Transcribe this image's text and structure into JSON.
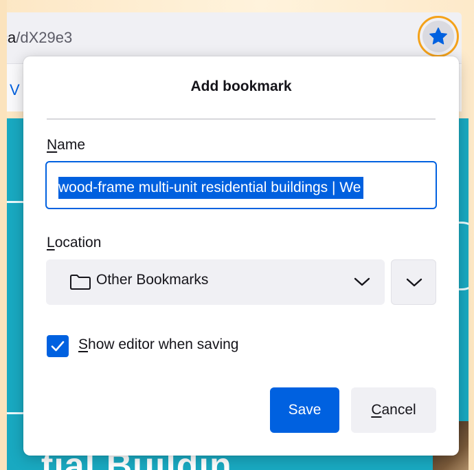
{
  "browser": {
    "url_prefix": "ca",
    "url_rest": "/dX29e3",
    "tab_letter": "V",
    "page_heading": "tial Buildin"
  },
  "panel": {
    "title": "Add bookmark",
    "name_label_accesskey": "N",
    "name_label_rest": "ame",
    "name_value": "wood-frame multi-unit residential buildings | We",
    "location_label_accesskey": "L",
    "location_label_rest": "ocation",
    "location_value": "Other Bookmarks",
    "checkbox_checked": true,
    "checkbox_label_accesskey": "S",
    "checkbox_label_rest": "how editor when saving",
    "save_label": "Save",
    "cancel_accesskey": "C",
    "cancel_rest": "ancel"
  },
  "icons": {
    "bookmark_star": "star-icon",
    "folder": "folder-icon",
    "chevron": "chevron-down-icon",
    "check": "check-icon"
  },
  "colors": {
    "accent": "#0061e0",
    "star_highlight": "#f4a21a",
    "page_bg": "#19a9c1"
  }
}
